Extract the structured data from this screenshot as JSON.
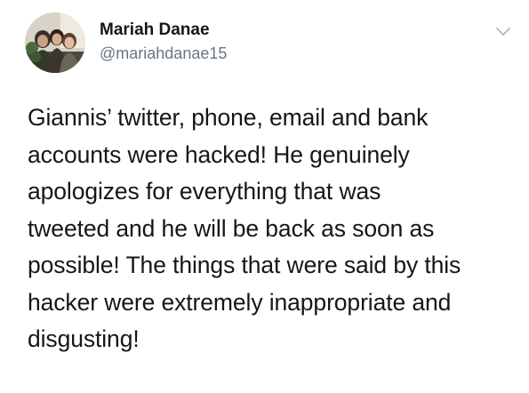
{
  "author": {
    "display_name": "Mariah Danae",
    "handle": "@mariahdanae15",
    "avatar_icon": "profile-photo-group"
  },
  "menu": {
    "icon": "chevron-down-icon"
  },
  "tweet": {
    "lines": [
      "Giannis’ twitter, phone, email and bank",
      "accounts were hacked! He genuinely",
      "apologizes for everything that was",
      "tweeted and he will be back as soon as",
      "possible! The things that were said by this",
      "hacker were extremely inappropriate and",
      "disgusting!"
    ]
  },
  "colors": {
    "text": "#14171a",
    "secondary": "#657786",
    "chevron": "#aab8c2",
    "background": "#ffffff"
  }
}
